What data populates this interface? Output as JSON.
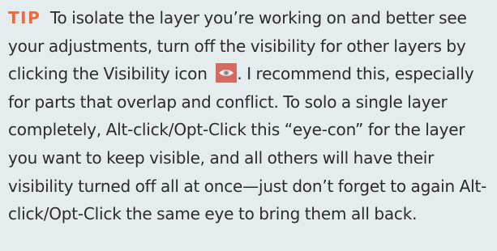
{
  "tip": {
    "label": "TIP",
    "text_before_icon": "To isolate the layer you’re working on and better see your adjustments, turn off the visibility for other layers by clicking the Visibility icon",
    "icon": "eye-icon",
    "text_after_icon": ". I recommend this, especially for parts that overlap and conflict. To solo a single layer completely, Alt-click/Opt-Click this “eye-con” for the layer you want to keep visible, and all others will have their visibility turned off all at once—just don’t forget to again Alt-click/Opt-Click the same eye to bring them all back."
  },
  "colors": {
    "background": "#e5ecee",
    "label": "#ee6a41",
    "text": "#2b2b2b",
    "icon_background": "#d46a60"
  }
}
